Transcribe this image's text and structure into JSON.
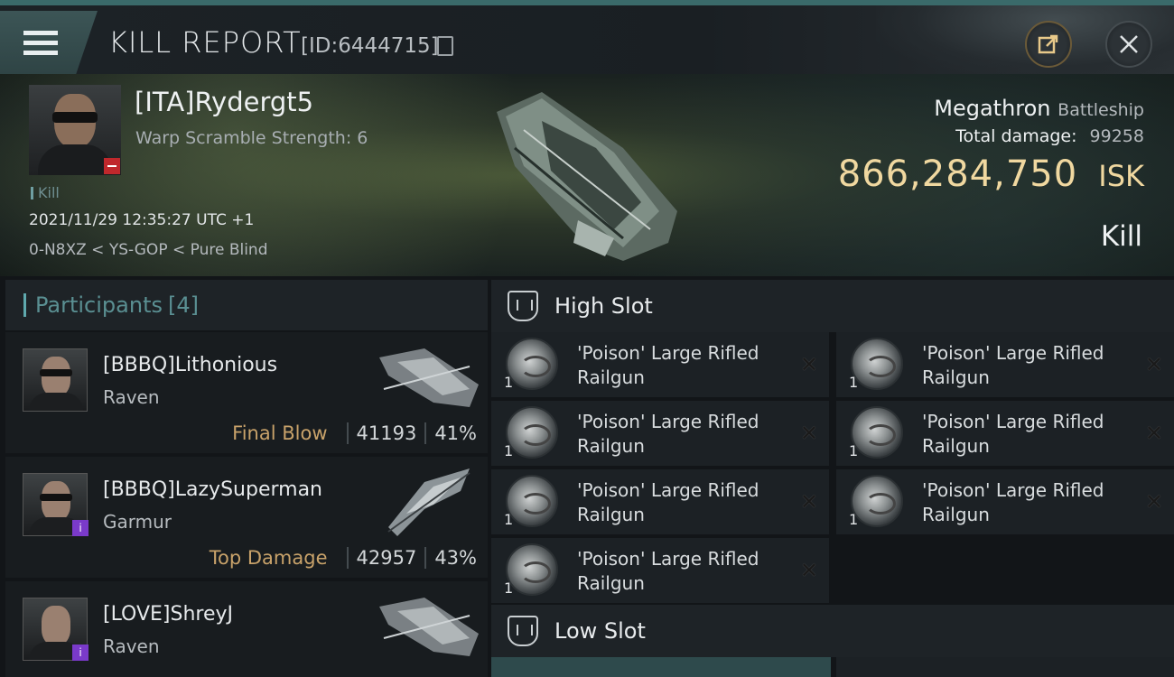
{
  "header": {
    "title": "KILL REPORT",
    "report_id": "[ID:6444715]"
  },
  "victim": {
    "name": "[ITA]Rydergt5",
    "warp_scramble": "Warp Scramble Strength: 6",
    "kill_tag": "Kill",
    "datetime": "2021/11/29 12:35:27 UTC +1",
    "location": "0-N8XZ < YS-GOP < Pure Blind",
    "ship_name": "Megathron",
    "ship_class": "Battleship",
    "total_damage_label": "Total damage:",
    "total_damage": "99258",
    "isk_value": "866,284,750",
    "isk_unit": "ISK",
    "result": "Kill"
  },
  "participants": {
    "label": "Participants",
    "count": "[4]",
    "rows": [
      {
        "name": "[BBBQ]Lithonious",
        "ship": "Raven",
        "tag": "Final Blow",
        "damage": "41193",
        "percent": "41%"
      },
      {
        "name": "[BBBQ]LazySuperman",
        "ship": "Garmur",
        "tag": "Top Damage",
        "damage": "42957",
        "percent": "43%"
      },
      {
        "name": "[LOVE]ShreyJ",
        "ship": "Raven",
        "tag": "",
        "damage": "",
        "percent": ""
      }
    ]
  },
  "slots": {
    "high_label": "High Slot",
    "low_label": "Low Slot",
    "high_modules": [
      {
        "name": "'Poison' Large Rifled Railgun",
        "qty": "1"
      },
      {
        "name": "'Poison' Large Rifled Railgun",
        "qty": "1"
      },
      {
        "name": "'Poison' Large Rifled Railgun",
        "qty": "1"
      },
      {
        "name": "'Poison' Large Rifled Railgun",
        "qty": "1"
      },
      {
        "name": "'Poison' Large Rifled Railgun",
        "qty": "1"
      },
      {
        "name": "'Poison' Large Rifled Railgun",
        "qty": "1"
      },
      {
        "name": "'Poison' Large Rifled Railgun",
        "qty": "1"
      }
    ]
  }
}
